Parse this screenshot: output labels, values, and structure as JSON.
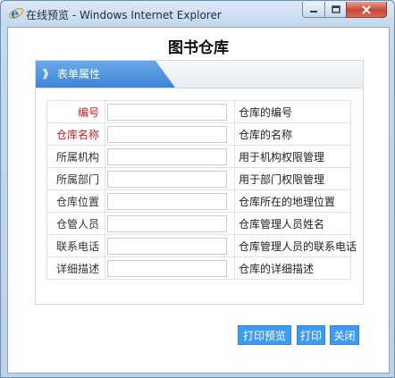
{
  "window": {
    "title": "在线预览 - Windows Internet Explorer",
    "icon": "ie-icon",
    "controls": [
      "minimize",
      "maximize",
      "close"
    ]
  },
  "page": {
    "title": "图书仓库"
  },
  "panel": {
    "tab_label": "表单属性",
    "tab_arrow": "》"
  },
  "fields": [
    {
      "label": "编号",
      "required": true,
      "value": "",
      "description": "仓库的编号"
    },
    {
      "label": "仓库名称",
      "required": true,
      "value": "",
      "description": "仓库的名称"
    },
    {
      "label": "所属机构",
      "required": false,
      "value": "",
      "description": "用于机构权限管理"
    },
    {
      "label": "所属部门",
      "required": false,
      "value": "",
      "description": "用于部门权限管理"
    },
    {
      "label": "仓库位置",
      "required": false,
      "value": "",
      "description": "仓库所在的地理位置"
    },
    {
      "label": "仓管人员",
      "required": false,
      "value": "",
      "description": "仓库管理人员姓名"
    },
    {
      "label": "联系电话",
      "required": false,
      "value": "",
      "description": "仓库管理人员的联系电话"
    },
    {
      "label": "详细描述",
      "required": false,
      "value": "",
      "description": "仓库的详细描述"
    }
  ],
  "buttons": {
    "print_preview": "打印预览",
    "print": "打印",
    "close": "关闭"
  },
  "colors": {
    "required_label": "#d21c1c",
    "tab_blue": "#4a90dd",
    "button_blue": "#3f9bf0"
  }
}
